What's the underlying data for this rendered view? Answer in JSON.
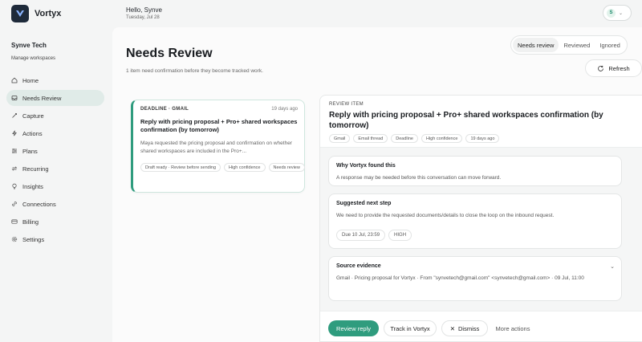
{
  "app": {
    "name": "Vortyx"
  },
  "header": {
    "greeting": "Hello, Synve",
    "date": "Tuesday, Jul 28",
    "account_initial": "S"
  },
  "sidebar": {
    "workspace_name": "Synve Tech",
    "manage_label": "Manage workspaces",
    "items": [
      {
        "label": "Home",
        "icon": "home-icon",
        "active": false
      },
      {
        "label": "Needs Review",
        "icon": "inbox-icon",
        "active": true
      },
      {
        "label": "Capture",
        "icon": "capture-icon",
        "active": false
      },
      {
        "label": "Actions",
        "icon": "actions-icon",
        "active": false
      },
      {
        "label": "Plans",
        "icon": "plans-icon",
        "active": false
      },
      {
        "label": "Recurring",
        "icon": "recurring-icon",
        "active": false
      },
      {
        "label": "Insights",
        "icon": "insights-icon",
        "active": false
      },
      {
        "label": "Connections",
        "icon": "connections-icon",
        "active": false
      },
      {
        "label": "Billing",
        "icon": "billing-icon",
        "active": false
      },
      {
        "label": "Settings",
        "icon": "settings-icon",
        "active": false
      }
    ]
  },
  "page": {
    "title": "Needs Review",
    "subtitle": "1 item need confirmation before they become tracked work.",
    "filters": [
      "Needs review",
      "Reviewed",
      "Ignored"
    ],
    "active_filter": "Needs review",
    "refresh_label": "Refresh"
  },
  "list": {
    "items": [
      {
        "kicker": "DEADLINE · GMAIL",
        "age": "19 days ago",
        "title": "Reply with pricing proposal + Pro+ shared workspaces confirmation (by tomorrow)",
        "description": "Maya requested the pricing proposal and confirmation on whether shared workspaces are included in the Pro+...",
        "tags": [
          "Draft ready · Review before sending",
          "High confidence",
          "Needs review"
        ]
      }
    ]
  },
  "detail": {
    "kicker": "REVIEW ITEM",
    "title": "Reply with pricing proposal + Pro+ shared workspaces confirmation (by tomorrow)",
    "tags": [
      "Gmail",
      "Email thread",
      "Deadline",
      "High confidence",
      "19 days ago"
    ],
    "why": {
      "heading": "Why Vortyx found this",
      "text": "A response may be needed before this conversation can move forward."
    },
    "next_step": {
      "heading": "Suggested next step",
      "text": "We need to provide the requested documents/details to close the loop on the inbound request.",
      "due": "Due 10 Jul, 23:59",
      "priority": "HIGH"
    },
    "evidence": {
      "heading": "Source evidence",
      "text": "Gmail · Pricing proposal for Vortyx · From \"synvetech@gmail.com\" <synvetech@gmail.com> · 09 Jul, 11:00"
    },
    "actions": {
      "primary": "Review reply",
      "track": "Track in Vortyx",
      "dismiss": "Dismiss",
      "more": "More actions"
    }
  },
  "colors": {
    "accent": "#2f9c7e",
    "sidebar_active": "#e0ebe8",
    "logo_bg": "#1e2a3a"
  }
}
